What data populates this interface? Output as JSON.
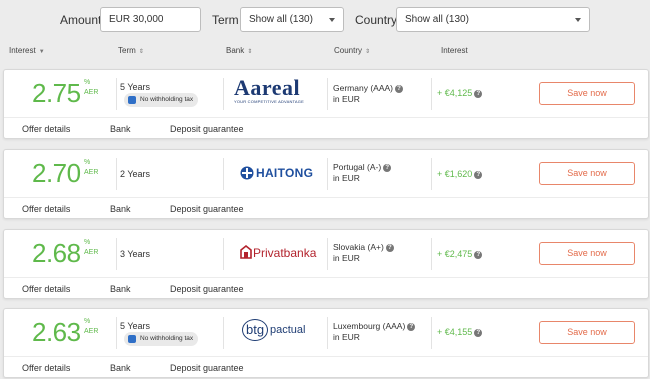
{
  "filters": {
    "amount_label": "Amount",
    "amount_value": "EUR 30,000",
    "term_label": "Term",
    "term_value": "Show all (130)",
    "country_label": "Country",
    "country_value": "Show all (130)"
  },
  "columns": {
    "interest": "Interest",
    "term": "Term",
    "bank": "Bank",
    "country": "Country",
    "interest_amount": "Interest"
  },
  "colors": {
    "rate_green": "#5fb94b",
    "save_orange": "#e36b4a"
  },
  "offers": [
    {
      "rate": "2.75",
      "pct": "%",
      "aer": "AER",
      "term": "5 Years",
      "badge": "No withholding tax",
      "bank_logo": "Aareal",
      "bank_tagline": "YOUR COMPETITIVE ADVANTAGE",
      "country": "Germany (AAA)",
      "currency": "in EUR",
      "interest": "+ €4,125",
      "save": "Save now",
      "links": {
        "details": "Offer details",
        "bank": "Bank",
        "guarantee": "Deposit guarantee"
      }
    },
    {
      "rate": "2.70",
      "pct": "%",
      "aer": "AER",
      "term": "2 Years",
      "bank_logo": "HAITONG",
      "country": "Portugal (A-)",
      "currency": "in EUR",
      "interest": "+ €1,620",
      "save": "Save now",
      "links": {
        "details": "Offer details",
        "bank": "Bank",
        "guarantee": "Deposit guarantee"
      }
    },
    {
      "rate": "2.68",
      "pct": "%",
      "aer": "AER",
      "term": "3 Years",
      "bank_logo": "Privatbanka",
      "country": "Slovakia (A+)",
      "currency": "in EUR",
      "interest": "+ €2,475",
      "save": "Save now",
      "links": {
        "details": "Offer details",
        "bank": "Bank",
        "guarantee": "Deposit guarantee"
      }
    },
    {
      "rate": "2.63",
      "pct": "%",
      "aer": "AER",
      "term": "5 Years",
      "badge": "No withholding tax",
      "bank_logo_a": "btg",
      "bank_logo_b": "pactual",
      "country": "Luxembourg (AAA)",
      "currency": "in EUR",
      "interest": "+ €4,155",
      "save": "Save now",
      "links": {
        "details": "Offer details",
        "bank": "Bank",
        "guarantee": "Deposit guarantee"
      }
    }
  ]
}
